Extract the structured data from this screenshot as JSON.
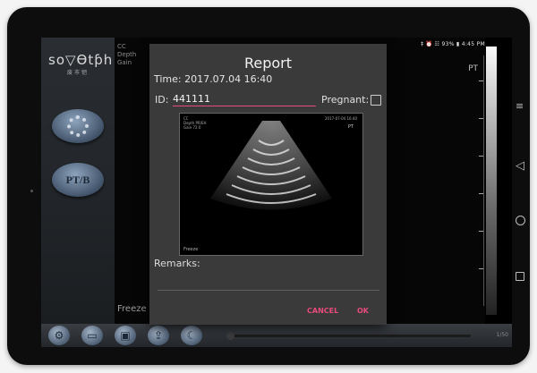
{
  "status_bar": {
    "text": "‡ ⏰ ☷ 93% ▮ 4:45 PM"
  },
  "sidebar": {
    "brand_logo": "so▽Ɵtƥh",
    "brand_sub": "废市钯",
    "gear_button_icon": "gear-icon",
    "ptb_button_label": "PT/B"
  },
  "main": {
    "overlay_lines": [
      "CC",
      "Depth",
      "Gain"
    ],
    "freeze_label": "Freeze",
    "pt_label": "PT"
  },
  "dialog": {
    "title": "Report",
    "time": "Time: 2017.07.04 16:40",
    "id_label": "ID:",
    "id_value": "441111",
    "pregnant_label": "Pregnant:",
    "pregnant_checked": false,
    "preview": {
      "header_lines": [
        "CC",
        "Depth  PR/EH",
        "Gain  72.0"
      ],
      "right_text": "2017-07-04  16:40",
      "pt_label": "PT",
      "freeze_label": "Freeze"
    },
    "remarks_label": "Remarks:",
    "cancel_label": "CANCEL",
    "ok_label": "OK",
    "accent_color": "#e94b7c"
  },
  "toolbar": {
    "buttons": [
      "settings-icon",
      "folder-icon",
      "save-icon",
      "export-icon",
      "moon-icon"
    ],
    "counter": "1/50"
  },
  "android_nav": {
    "menu_icon": "≡",
    "back_icon": "◁"
  }
}
